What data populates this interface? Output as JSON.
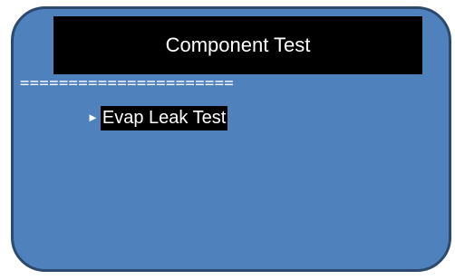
{
  "header": {
    "title": "Component Test"
  },
  "divider": {
    "text": "======================"
  },
  "menu": {
    "items": [
      {
        "label": "Evap Leak Test",
        "selected": true,
        "icon": "arrow-right-icon"
      }
    ]
  },
  "colors": {
    "screen_background": "#4f81bd",
    "screen_border": "#2c4a6e",
    "title_background": "#000000",
    "text": "#ffffff",
    "selected_background": "#000000"
  }
}
